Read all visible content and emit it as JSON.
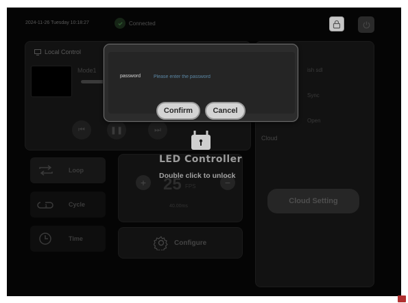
{
  "status": {
    "datetime": "2024-11-26 Tuesday 10:18:27",
    "connection": "Connected"
  },
  "local_control": {
    "title": "Local Control",
    "mode": "Mode1"
  },
  "right_panel": {
    "row1": "ish sdl",
    "row2": "Sync",
    "row3": "Open",
    "cloud_label": "Cloud",
    "cloud_button": "Cloud Setting"
  },
  "modes": [
    {
      "label": "Loop"
    },
    {
      "label": "Cycle"
    },
    {
      "label": "Time"
    }
  ],
  "fps": {
    "value": "25",
    "unit": "FPS",
    "interval": "40.00ms"
  },
  "configure": {
    "label": "Configure"
  },
  "lock_overlay": {
    "title": "LED Controller",
    "hint": "Double click to unlock"
  },
  "dialog": {
    "password_label": "password",
    "password_placeholder": "Please enter the password",
    "password_value": "",
    "confirm": "Confirm",
    "cancel": "Cancel"
  },
  "colors": {
    "background": "#050505",
    "dialog_bg": "#2c2c2c",
    "button_bg": "#d4d4d4",
    "placeholder": "#5c88a6",
    "status_ok": "#2fae3a"
  },
  "icons": {
    "lock": "lock-icon",
    "power": "power-icon",
    "monitor": "monitor-icon",
    "padlock": "padlock-icon",
    "loop": "loop-icon",
    "cycle": "cycle-icon",
    "clock": "clock-icon",
    "gear": "gear-icon"
  }
}
